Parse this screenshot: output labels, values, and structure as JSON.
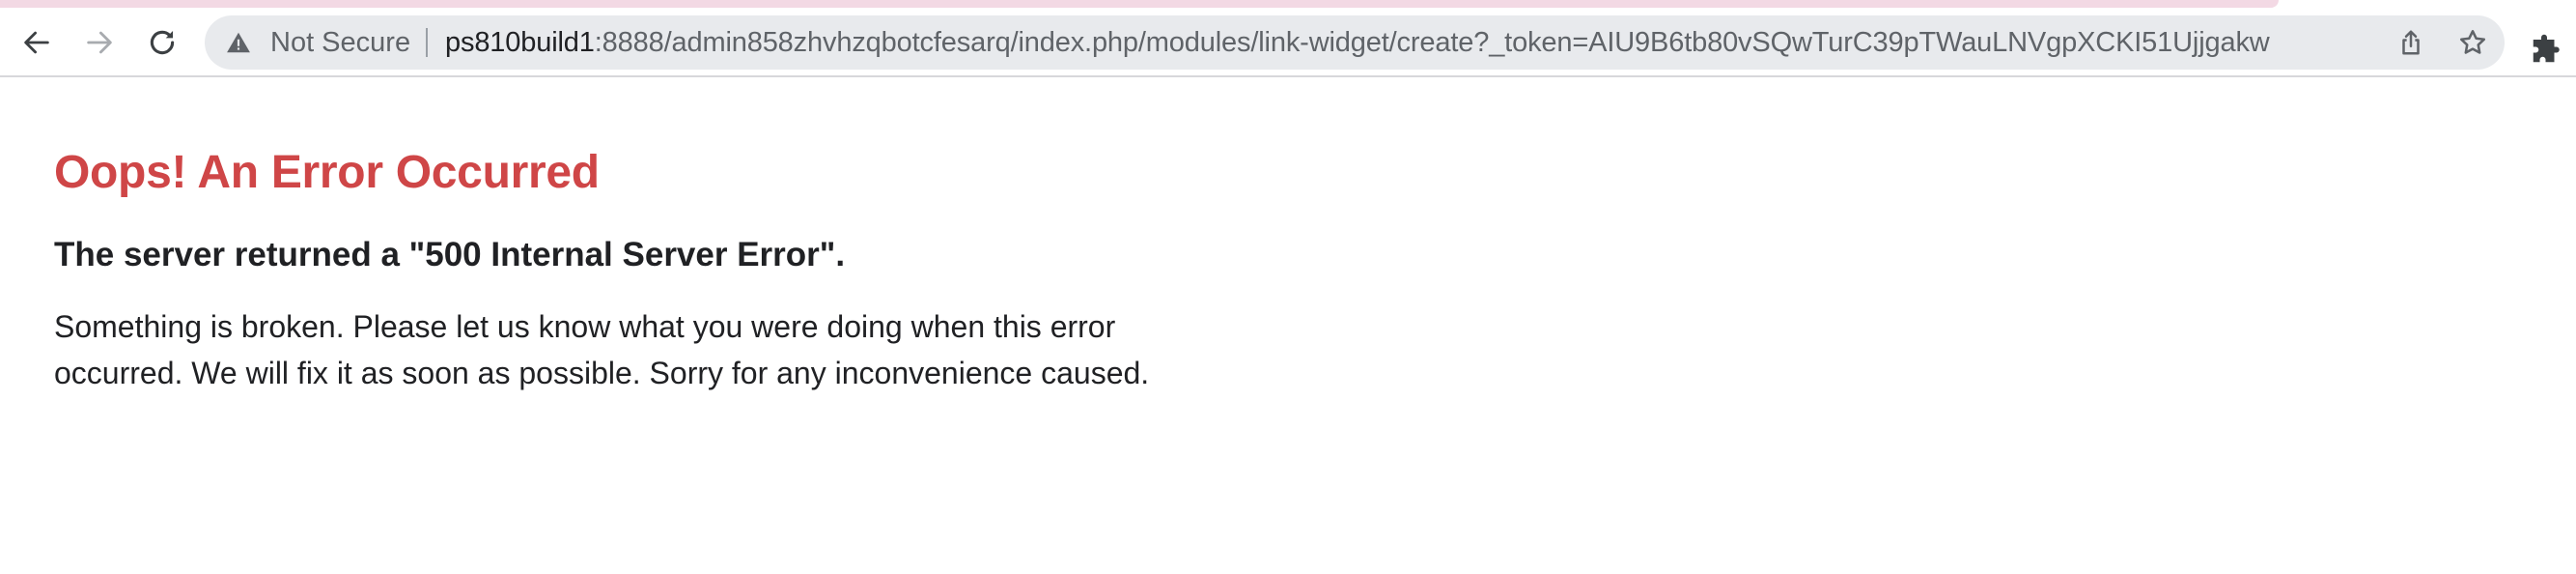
{
  "browser": {
    "security_label": "Not Secure",
    "url_host": "ps810build1",
    "url_rest": ":8888/admin858zhvhzqbotcfesarq/index.php/modules/link-widget/create?_token=AIU9B6tb80vSQwTurC39pTWauLNVgpXCKI51Ujjgakw",
    "icons": {
      "back": "back-arrow-icon",
      "forward": "forward-arrow-icon",
      "reload": "reload-icon",
      "warning": "warning-triangle-icon",
      "share": "share-icon",
      "bookmark": "star-icon",
      "extensions": "puzzle-piece-icon"
    },
    "colors": {
      "tab_tint": "#f3d9e4",
      "omnibox_bg": "#e8eaed"
    }
  },
  "page": {
    "title": "Oops! An Error Occurred",
    "subtitle": "The server returned a \"500 Internal Server Error\".",
    "message": "Something is broken. Please let us know what you were doing when this error occurred. We will fix it as soon as possible. Sorry for any inconvenience caused.",
    "colors": {
      "title": "#cf4647",
      "text": "#202124"
    }
  }
}
